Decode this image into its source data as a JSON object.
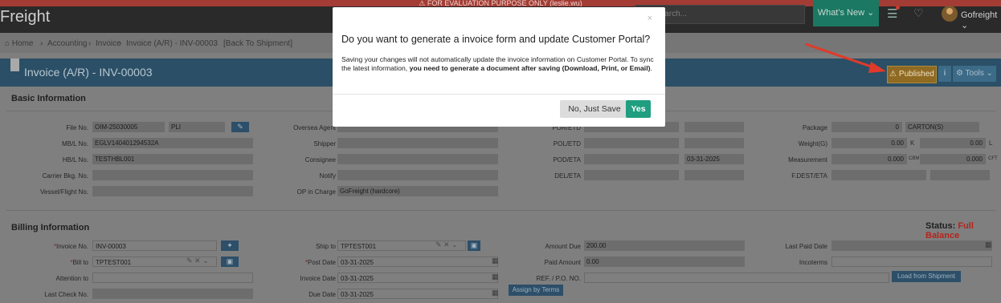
{
  "banner": {
    "text": "⚠ FOR EVALUATION PURPOSE ONLY (leslie.wu)"
  },
  "topnav": {
    "brand": "Freight",
    "search_placeholder": "Search...",
    "whats_new": "What's New ⌄",
    "user": "Gofreight ⌄"
  },
  "breadcrumb": {
    "home": "⌂ Home",
    "accounting": "Accounting",
    "invoice": "Invoice",
    "current": "Invoice (A/R) - INV-00003",
    "back": "[Back To Shipment]"
  },
  "header": {
    "title": "Invoice (A/R) - INV-00003",
    "published": "⚠ Published",
    "info": "i",
    "tools": "⚙ Tools ⌄"
  },
  "basic": {
    "section": "Basic Information",
    "file_no_label": "File No.",
    "file_no": "OIM-25030005",
    "file_type": "PLI",
    "mbl_label": "MB/L No.",
    "mbl": "EGLV140401294532A",
    "hbl_label": "HB/L No.",
    "hbl": "TESTHBL001",
    "carrier_label": "Carrier Bkg. No.",
    "vessel_label": "Vessel/Flight No.",
    "oversea_label": "Oversea Agent",
    "shipper_label": "Shipper",
    "consignee_label": "Consignee",
    "notify_label": "Notify",
    "op_label": "OP in Charge",
    "op": "GoFreight (hardcore)",
    "por_label": "POR/ETD",
    "pol_label": "POL/ETD",
    "pod_label": "POD/ETA",
    "pod_date": "03-31-2025",
    "del_label": "DEL/ETA",
    "package_label": "Package",
    "package": "0",
    "package_unit": "CARTON(S)",
    "weight_label": "Weight(G)",
    "weight_k": "0.00",
    "k": "K",
    "weight_l": "0.00",
    "l": "L",
    "measure_label": "Measurement",
    "measure_cbm": "0.000",
    "cbm": "CBM",
    "measure_cft": "0.000",
    "cft": "CFT",
    "fdest_label": "F.DEST/ETA"
  },
  "billing": {
    "section": "Billing Information",
    "status_label": "Status:",
    "status": "Full Balance",
    "invoice_no_label": "Invoice No.",
    "invoice_no": "INV-00003",
    "bill_to_label": "Bill to",
    "bill_to": "TPTEST001",
    "attention_label": "Attention to",
    "last_check_label": "Last Check No.",
    "ship_to_label": "Ship to",
    "ship_to": "TPTEST001",
    "post_date_label": "Post Date",
    "post_date": "03-31-2025",
    "invoice_date_label": "Invoice Date",
    "invoice_date": "03-31-2025",
    "due_date_label": "Due Date",
    "due_date": "03-31-2025",
    "assign_terms": "Assign by Terms",
    "amount_due_label": "Amount Due",
    "amount_due": "200.00",
    "paid_amount_label": "Paid Amount",
    "paid_amount": "0.00",
    "ref_label": "REF. / P.O. NO.",
    "last_paid_label": "Last Paid Date",
    "incoterms_label": "Incoterms",
    "load_shipment": "Load from Shipment"
  },
  "modal": {
    "close": "×",
    "title": "Do you want to generate a invoice form and update Customer Portal?",
    "body_plain": "Saving your changes will not automatically update the invoice information on Customer Portal. To sync the latest information, ",
    "body_bold": "you need to generate a document after saving (Download, Print, or Email)",
    "body_end": ".",
    "no_label": "No, Just Save",
    "yes_label": "Yes"
  },
  "colors": {
    "accent": "#1f9e80",
    "header_blue": "#2b4f66",
    "published": "#8f6a22",
    "arrow": "#e03a2a",
    "status_red": "#b3251b"
  },
  "icons": [
    "warning-icon",
    "search-icon",
    "list-icon",
    "bell-icon",
    "home-icon",
    "info-icon",
    "gear-icon",
    "edit-icon",
    "calendar-icon",
    "close-icon"
  ]
}
